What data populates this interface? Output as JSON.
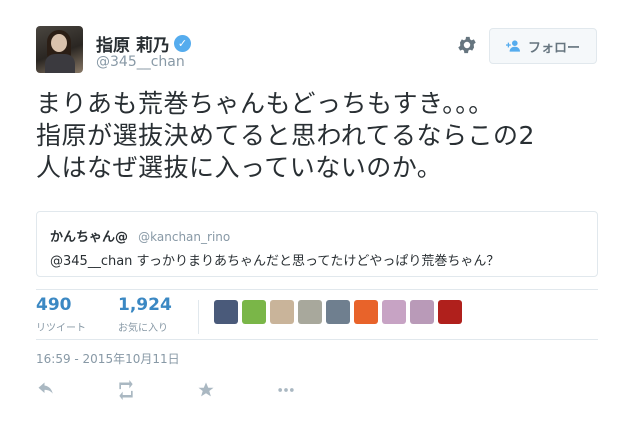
{
  "author": {
    "display_name": "指原 莉乃",
    "handle": "@345__chan",
    "verified": true
  },
  "header": {
    "gear_icon": "gear-icon",
    "follow_button_label": "フォロー",
    "follow_icon": "add-person-icon"
  },
  "tweet": {
    "text_lines": [
      "まりあも荒巻ちゃんもどっちもすき。。。",
      "指原が選抜決めてると思われてるならこの2",
      "人はなぜ選抜に入っていないのか。"
    ]
  },
  "quoted_tweet": {
    "name": "かんちゃん@",
    "handle": "@kanchan_rino",
    "text": "@345__chan すっかりまりあちゃんだと思ってたけどやっぱり荒巻ちゃん？"
  },
  "stats": {
    "retweets": {
      "count": "490",
      "label": "リツイート"
    },
    "likes": {
      "count": "1,924",
      "label": "お気に入り"
    }
  },
  "liker_avatars": [
    {
      "color": "#4a5a7a"
    },
    {
      "color": "#7ab648"
    },
    {
      "color": "#c9b49a"
    },
    {
      "color": "#a8a89c"
    },
    {
      "color": "#6f7f8f"
    },
    {
      "color": "#e8632a"
    },
    {
      "color": "#c7a3c4"
    },
    {
      "color": "#b99ab8"
    },
    {
      "color": "#b0201c"
    }
  ],
  "timestamp": "16:59 - 2015年10月11日",
  "actions": [
    "reply-icon",
    "retweet-icon",
    "favorite-icon",
    "more-icon"
  ],
  "colors": {
    "link_blue": "#3b88c3",
    "muted_gray": "#8899a6",
    "verified_blue": "#55acee"
  }
}
